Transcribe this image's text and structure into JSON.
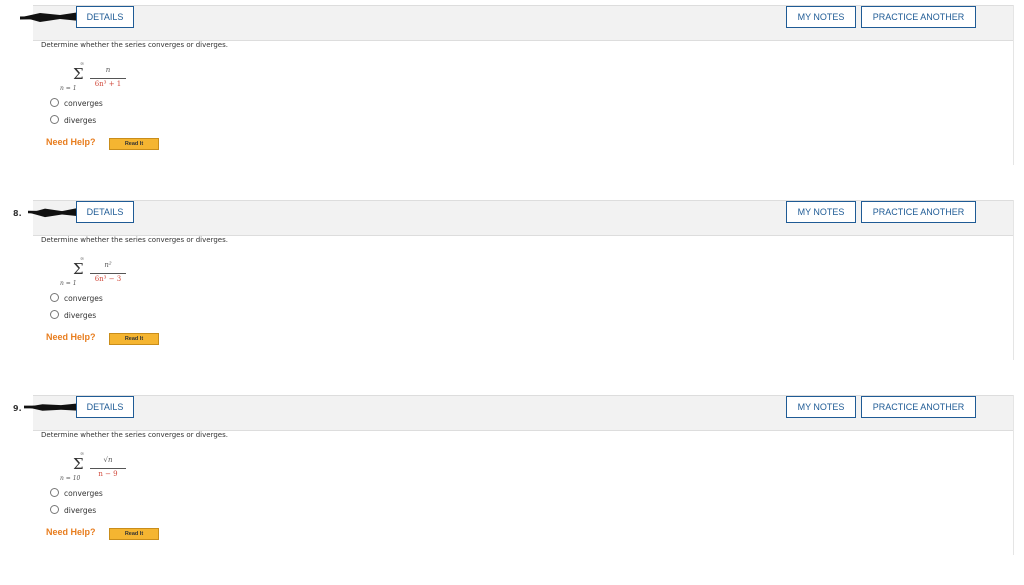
{
  "questions": [
    {
      "number": "",
      "details_label": "DETAILS",
      "my_notes_label": "MY NOTES",
      "practice_label": "PRACTICE ANOTHER",
      "prompt": "Determine whether the series converges or diverges.",
      "series": {
        "sup": "∞",
        "sub": "n = 1",
        "numerator": "n",
        "denominator": "6n³ + 1"
      },
      "options": [
        "converges",
        "diverges"
      ],
      "need_help": "Need Help?",
      "read_it": "Read It"
    },
    {
      "number": "8.",
      "details_label": "DETAILS",
      "my_notes_label": "MY NOTES",
      "practice_label": "PRACTICE ANOTHER",
      "prompt": "Determine whether the series converges or diverges.",
      "series": {
        "sup": "∞",
        "sub": "n = 1",
        "numerator": "n²",
        "denominator": "6n³ − 3"
      },
      "options": [
        "converges",
        "diverges"
      ],
      "need_help": "Need Help?",
      "read_it": "Read It"
    },
    {
      "number": "9.",
      "details_label": "DETAILS",
      "my_notes_label": "MY NOTES",
      "practice_label": "PRACTICE ANOTHER",
      "prompt": "Determine whether the series converges or diverges.",
      "series": {
        "sup": "∞",
        "sub": "n = 10",
        "numerator": "√n",
        "denominator": "n − 9"
      },
      "options": [
        "converges",
        "diverges"
      ],
      "need_help": "Need Help?",
      "read_it": "Read It"
    }
  ]
}
